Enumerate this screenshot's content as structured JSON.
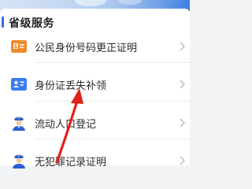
{
  "section": {
    "title": "省级服务"
  },
  "services": [
    {
      "label": "公民身份号码更正证明",
      "icon": "id-card-icon"
    },
    {
      "label": "身份证丢失补领",
      "icon": "id-badge-icon"
    },
    {
      "label": "流动人口登记",
      "icon": "police-officer-icon"
    },
    {
      "label": "无犯罪记录证明",
      "icon": "police-officer-icon"
    }
  ],
  "colors": {
    "accent": "#2f6bf0",
    "annotation_arrow": "#e0201b",
    "icon_orange": "#f08a2c",
    "icon_blue": "#3b7cf2"
  },
  "annotation": {
    "type": "arrow",
    "points_to": "身份证丢失补领"
  }
}
